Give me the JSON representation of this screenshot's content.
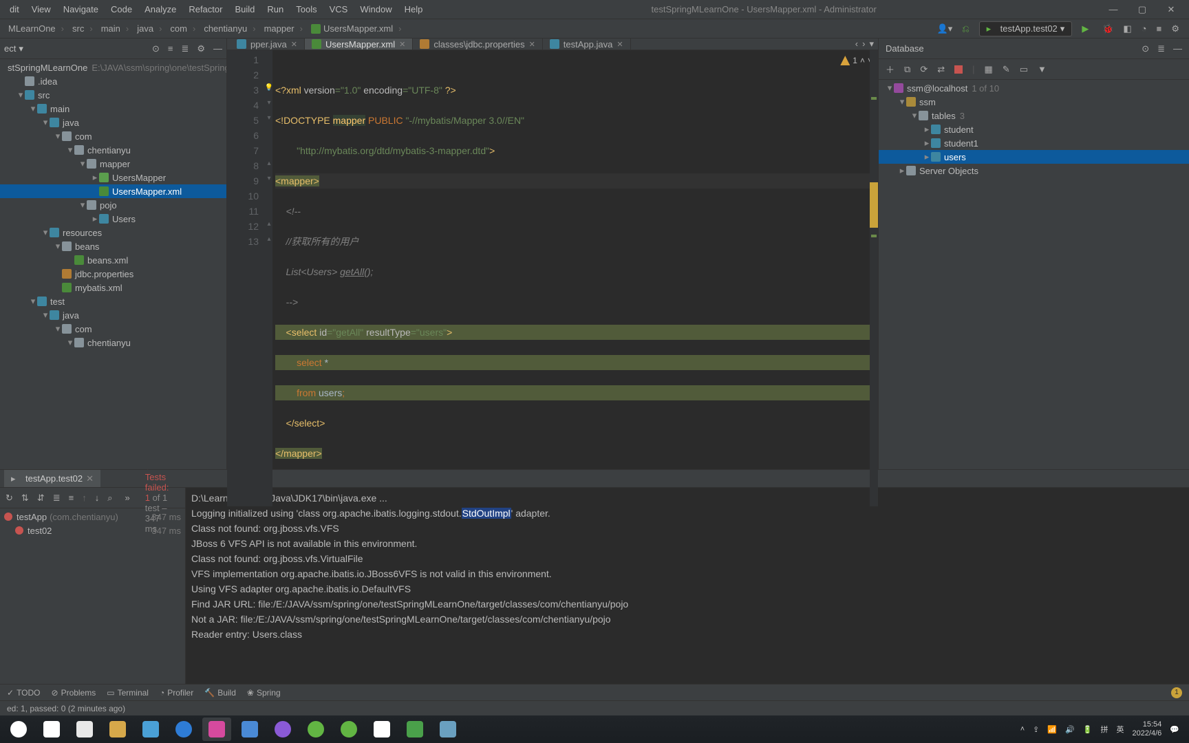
{
  "menubar": {
    "items": [
      "dit",
      "View",
      "Navigate",
      "Code",
      "Analyze",
      "Refactor",
      "Build",
      "Run",
      "Tools",
      "VCS",
      "Window",
      "Help"
    ],
    "title": "testSpringMLearnOne - UsersMapper.xml - Administrator",
    "win_min": "—",
    "win_max": "▢",
    "win_close": "✕"
  },
  "breadcrumbs": {
    "items": [
      "MLearnOne",
      "src",
      "main",
      "java",
      "com",
      "chentianyu",
      "mapper",
      "UsersMapper.xml"
    ]
  },
  "run_config": {
    "label": "testApp.test02"
  },
  "project_tree": {
    "header": "ect",
    "rows": [
      {
        "indent": 0,
        "tog": "",
        "icon": "ico-folder",
        "label": "stSpringMLearnOne",
        "extra": "E:\\JAVA\\ssm\\spring\\one\\testSpring"
      },
      {
        "indent": 1,
        "tog": "",
        "icon": "ico-folder",
        "label": ".idea"
      },
      {
        "indent": 1,
        "tog": "▾",
        "icon": "ico-blue",
        "label": "src"
      },
      {
        "indent": 2,
        "tog": "▾",
        "icon": "ico-blue",
        "label": "main"
      },
      {
        "indent": 3,
        "tog": "▾",
        "icon": "ico-blue",
        "label": "java"
      },
      {
        "indent": 4,
        "tog": "▾",
        "icon": "ico-folder",
        "label": "com"
      },
      {
        "indent": 5,
        "tog": "▾",
        "icon": "ico-folder",
        "label": "chentianyu"
      },
      {
        "indent": 6,
        "tog": "▾",
        "icon": "ico-folder",
        "label": "mapper"
      },
      {
        "indent": 7,
        "tog": "▸",
        "icon": "ico-intf",
        "label": "UsersMapper"
      },
      {
        "indent": 7,
        "tog": "",
        "icon": "ico-xml",
        "label": "UsersMapper.xml",
        "sel": true
      },
      {
        "indent": 6,
        "tog": "▾",
        "icon": "ico-folder",
        "label": "pojo"
      },
      {
        "indent": 7,
        "tog": "▸",
        "icon": "ico-class",
        "label": "Users"
      },
      {
        "indent": 3,
        "tog": "▾",
        "icon": "ico-blue",
        "label": "resources"
      },
      {
        "indent": 4,
        "tog": "▾",
        "icon": "ico-folder",
        "label": "beans"
      },
      {
        "indent": 5,
        "tog": "",
        "icon": "ico-xml",
        "label": "beans.xml"
      },
      {
        "indent": 4,
        "tog": "",
        "icon": "ico-prop",
        "label": "jdbc.properties"
      },
      {
        "indent": 4,
        "tog": "",
        "icon": "ico-xml",
        "label": "mybatis.xml"
      },
      {
        "indent": 2,
        "tog": "▾",
        "icon": "ico-blue",
        "label": "test"
      },
      {
        "indent": 3,
        "tog": "▾",
        "icon": "ico-blue",
        "label": "java"
      },
      {
        "indent": 4,
        "tog": "▾",
        "icon": "ico-folder",
        "label": "com"
      },
      {
        "indent": 5,
        "tog": "▾",
        "icon": "ico-folder",
        "label": "chentianyu"
      }
    ]
  },
  "editor_tabs": {
    "items": [
      {
        "icon": "#3e86a0",
        "label": "pper.java",
        "active": false
      },
      {
        "icon": "#4a8a3a",
        "label": "UsersMapper.xml",
        "active": true
      },
      {
        "icon": "#b07b34",
        "label": "classes\\jdbc.properties",
        "active": false
      },
      {
        "icon": "#3e86a0",
        "label": "testApp.java",
        "active": false
      }
    ]
  },
  "editor": {
    "warning_count": "1",
    "line_numbers": [
      "1",
      "2",
      "3",
      "4",
      "5",
      "6",
      "7",
      "8",
      "9",
      "10",
      "11",
      "12",
      "13"
    ],
    "breadcrumb": "mapper"
  },
  "code_lines": {
    "l1_a": "<?xml",
    "l1_b": " version",
    "l1_c": "=\"1.0\"",
    "l1_d": " encoding",
    "l1_e": "=\"UTF-8\"",
    "l1_f": " ?>",
    "l2_a": "<!DOCTYPE ",
    "l2_b": "mapper",
    "l2_c": " PUBLIC ",
    "l2_d": "\"-//mybatis/Mapper 3.0//EN\"",
    "l3_a": "        ",
    "l3_b": "\"http://mybatis.org/dtd/mybatis-3-mapper.dtd\"",
    "l3_c": ">",
    "l4_a": "<mapper>",
    "l5_a": "    <!--",
    "l6_a": "    //获取所有的用户",
    "l7_a": "    List<Users> ",
    "l7_b": "getAll",
    "l7_c": "();",
    "l8_a": "    -->",
    "l9_a": "    <select ",
    "l9_b": "id",
    "l9_c": "=\"getAll\" ",
    "l9_d": "resultType",
    "l9_e": "=\"users\"",
    "l9_f": ">",
    "l10_a": "        select ",
    "l10_b": "*",
    "l11_a": "        from ",
    "l11_b": "users",
    "l11_c": ";",
    "l12_a": "    </select>",
    "l13_a": "</mapper>"
  },
  "database": {
    "title": "Database",
    "rows": [
      {
        "indent": 0,
        "tog": "▾",
        "icon": "db-ds",
        "label": "ssm@localhost",
        "count": "1 of 10"
      },
      {
        "indent": 1,
        "tog": "▾",
        "icon": "db-schema",
        "label": "ssm"
      },
      {
        "indent": 2,
        "tog": "▾",
        "icon": "db-folder",
        "label": "tables",
        "count": "3"
      },
      {
        "indent": 3,
        "tog": "▸",
        "icon": "db-table",
        "label": "student"
      },
      {
        "indent": 3,
        "tog": "▸",
        "icon": "db-table",
        "label": "student1"
      },
      {
        "indent": 3,
        "tog": "▸",
        "icon": "db-table",
        "label": "users",
        "sel": true
      },
      {
        "indent": 1,
        "tog": "▸",
        "icon": "db-folder",
        "label": "Server Objects"
      }
    ]
  },
  "run": {
    "tab_label": "testApp.test02",
    "status_fail": "Tests failed: 1",
    "status_rest": " of 1 test – 347 ms",
    "tree": [
      {
        "indent": 0,
        "label": "testApp",
        "extra": "(com.chentianyu)",
        "time": "347 ms"
      },
      {
        "indent": 1,
        "label": "test02",
        "extra": "",
        "time": "347 ms"
      }
    ],
    "console": [
      {
        "pre": "D:\\LearnApp\\SDK\\Java\\JDK17\\bin\\java.exe ...",
        "hl": "",
        "post": ""
      },
      {
        "pre": "Logging initialized using 'class org.apache.ibatis.logging.stdout.",
        "hl": "StdOutImpl",
        "post": "' adapter."
      },
      {
        "pre": "Class not found: org.jboss.vfs.VFS",
        "hl": "",
        "post": ""
      },
      {
        "pre": "JBoss 6 VFS API is not available in this environment.",
        "hl": "",
        "post": ""
      },
      {
        "pre": "Class not found: org.jboss.vfs.VirtualFile",
        "hl": "",
        "post": ""
      },
      {
        "pre": "VFS implementation org.apache.ibatis.io.JBoss6VFS is not valid in this environment.",
        "hl": "",
        "post": ""
      },
      {
        "pre": "Using VFS adapter org.apache.ibatis.io.DefaultVFS",
        "hl": "",
        "post": ""
      },
      {
        "pre": "Find JAR URL: file:/E:/JAVA/ssm/spring/one/testSpringMLearnOne/target/classes/com/chentianyu/pojo",
        "hl": "",
        "post": ""
      },
      {
        "pre": "Not a JAR: file:/E:/JAVA/ssm/spring/one/testSpringMLearnOne/target/classes/com/chentianyu/pojo",
        "hl": "",
        "post": ""
      },
      {
        "pre": "Reader entry: Users.class",
        "hl": "",
        "post": ""
      }
    ]
  },
  "tool_tabs": [
    "TODO",
    "Problems",
    "Terminal",
    "Profiler",
    "Build",
    "Spring"
  ],
  "tool_badge": "1",
  "status_bar": "ed: 1, passed: 0 (2 minutes ago)",
  "taskbar": {
    "icons": [
      {
        "color": "#ffffff",
        "shape": "circle"
      },
      {
        "color": "#ffffff",
        "shape": "square"
      },
      {
        "color": "#e8e8e8",
        "shape": "square"
      },
      {
        "color": "#d6a84a",
        "shape": "square"
      },
      {
        "color": "#4aa0d6",
        "shape": "square"
      },
      {
        "color": "#2e7cd6",
        "shape": "circle"
      },
      {
        "color": "#d64a9e",
        "shape": "square",
        "active": true
      },
      {
        "color": "#4a8ad6",
        "shape": "square"
      },
      {
        "color": "#8a5ad6",
        "shape": "circle"
      },
      {
        "color": "#62b543",
        "shape": "circle"
      },
      {
        "color": "#62b543",
        "shape": "circle"
      },
      {
        "color": "#ffffff",
        "shape": "square"
      },
      {
        "color": "#4aa04a",
        "shape": "square"
      },
      {
        "color": "#6aa0c0",
        "shape": "square"
      }
    ],
    "ime1": "拼",
    "ime2": "英",
    "time": "15:54",
    "date": "2022/4/6"
  }
}
